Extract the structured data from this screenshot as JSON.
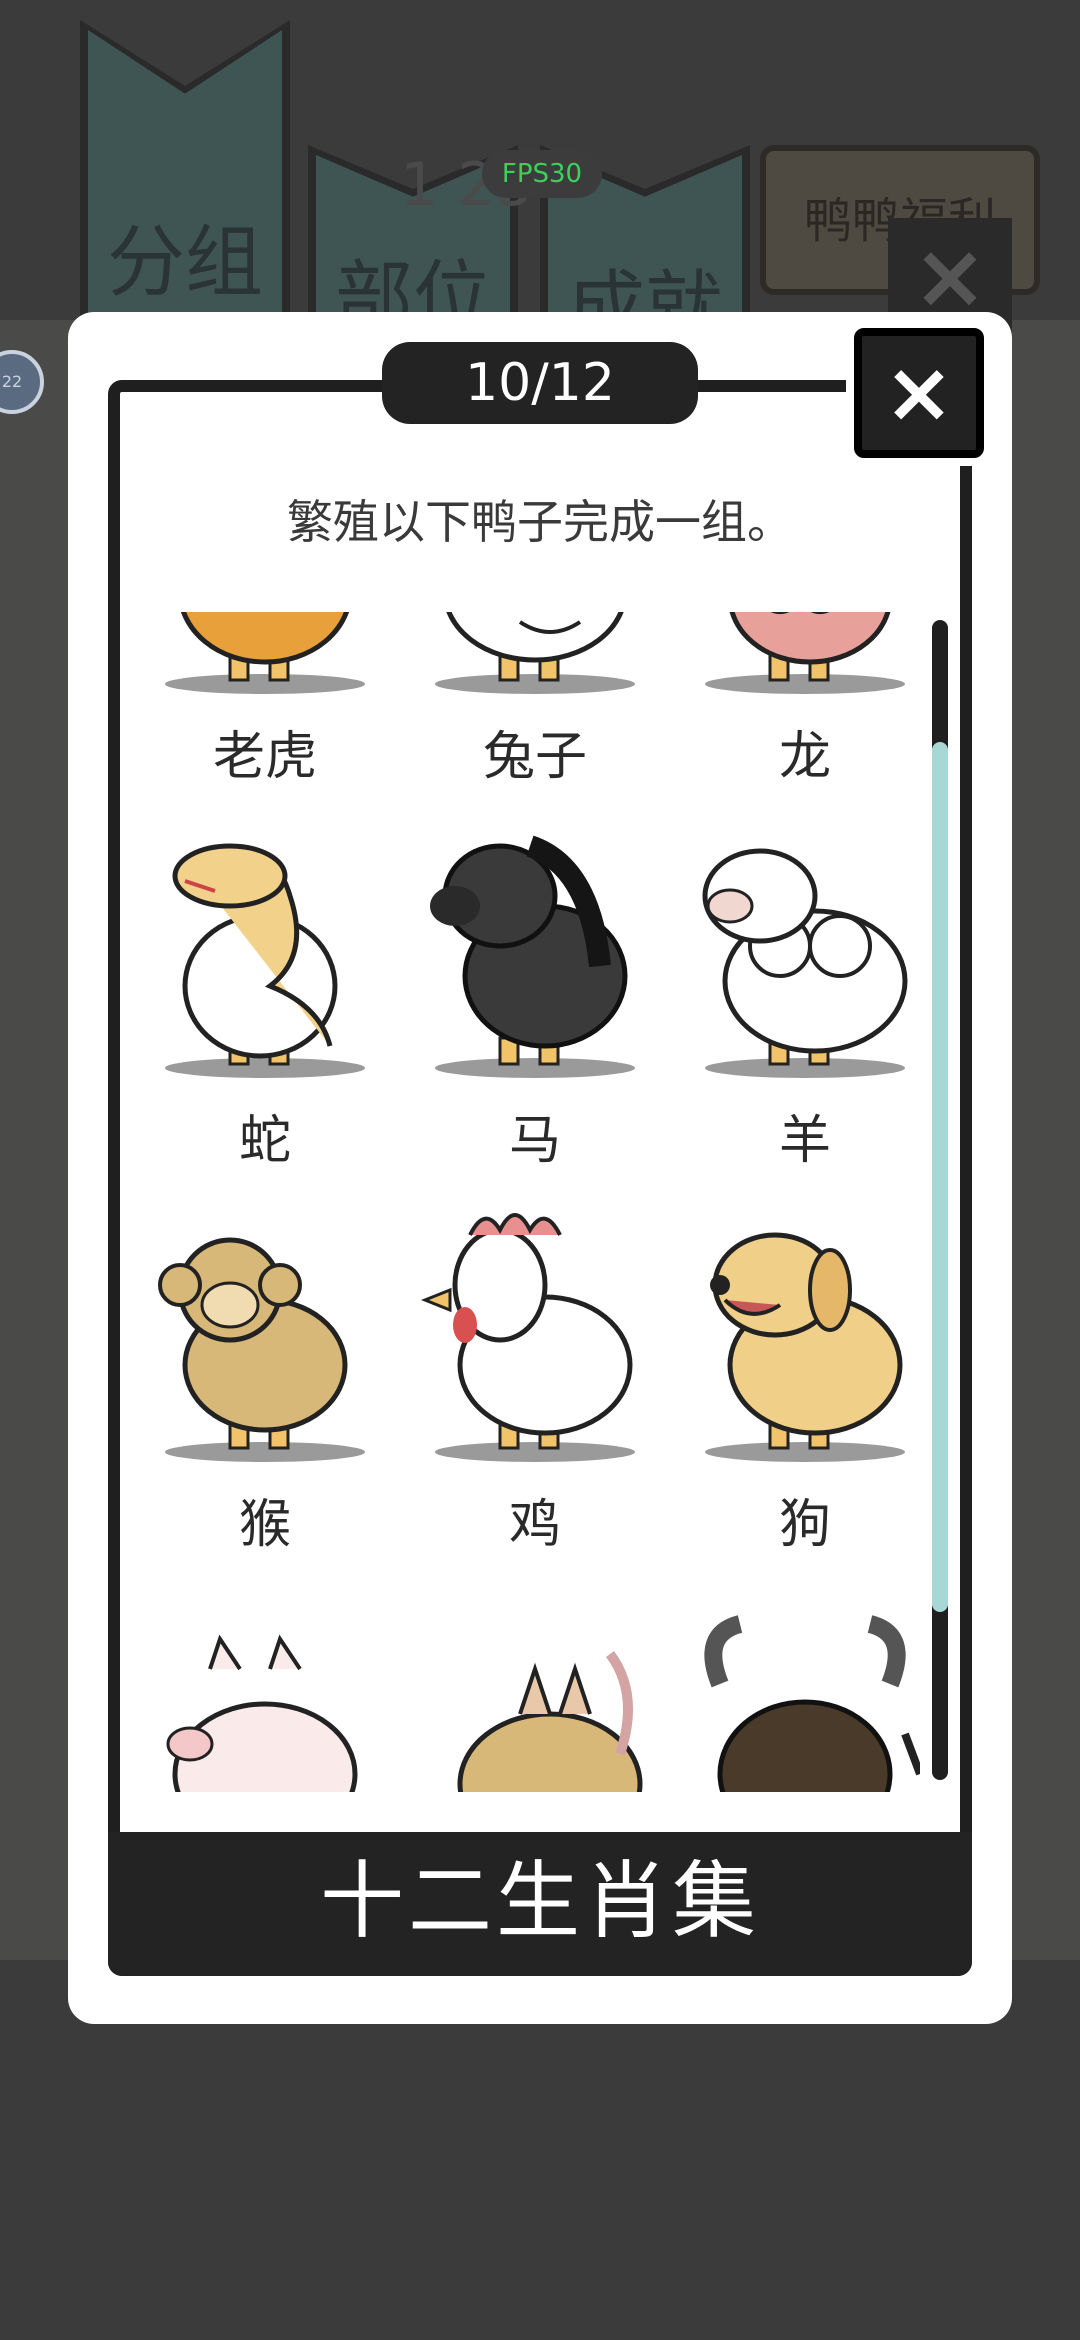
{
  "background": {
    "tabs": [
      {
        "label": "分组"
      },
      {
        "label": "部位"
      },
      {
        "label": "成就"
      }
    ],
    "welfare_tab": "鸭鸭福利",
    "counter": "1 25",
    "fps": "FPS30",
    "badge": "22"
  },
  "modal": {
    "progress": "10/12",
    "close_symbol": "×",
    "instruction": "繁殖以下鸭子完成一组。",
    "collection_title": "十二生肖集",
    "scroll_position": 0.42
  },
  "animals": [
    {
      "label": "老虎",
      "icon": "tiger-duck-icon"
    },
    {
      "label": "兔子",
      "icon": "rabbit-duck-icon"
    },
    {
      "label": "龙",
      "icon": "dragon-duck-icon"
    },
    {
      "label": "蛇",
      "icon": "snake-duck-icon"
    },
    {
      "label": "马",
      "icon": "horse-duck-icon"
    },
    {
      "label": "羊",
      "icon": "sheep-duck-icon"
    },
    {
      "label": "猴",
      "icon": "monkey-duck-icon"
    },
    {
      "label": "鸡",
      "icon": "rooster-duck-icon"
    },
    {
      "label": "狗",
      "icon": "dog-duck-icon"
    },
    {
      "label": "",
      "icon": "pig-duck-icon"
    },
    {
      "label": "",
      "icon": "rat-duck-icon"
    },
    {
      "label": "",
      "icon": "ox-duck-icon"
    }
  ],
  "colors": {
    "accent_scroll": "#a8d8d6",
    "dark": "#232323",
    "tiger": "#e8a03a",
    "snake": "#f2d28a",
    "horse": "#3a3a3a",
    "monkey": "#d8b878",
    "dog": "#f0cf88",
    "rooster_comb": "#e89090"
  }
}
